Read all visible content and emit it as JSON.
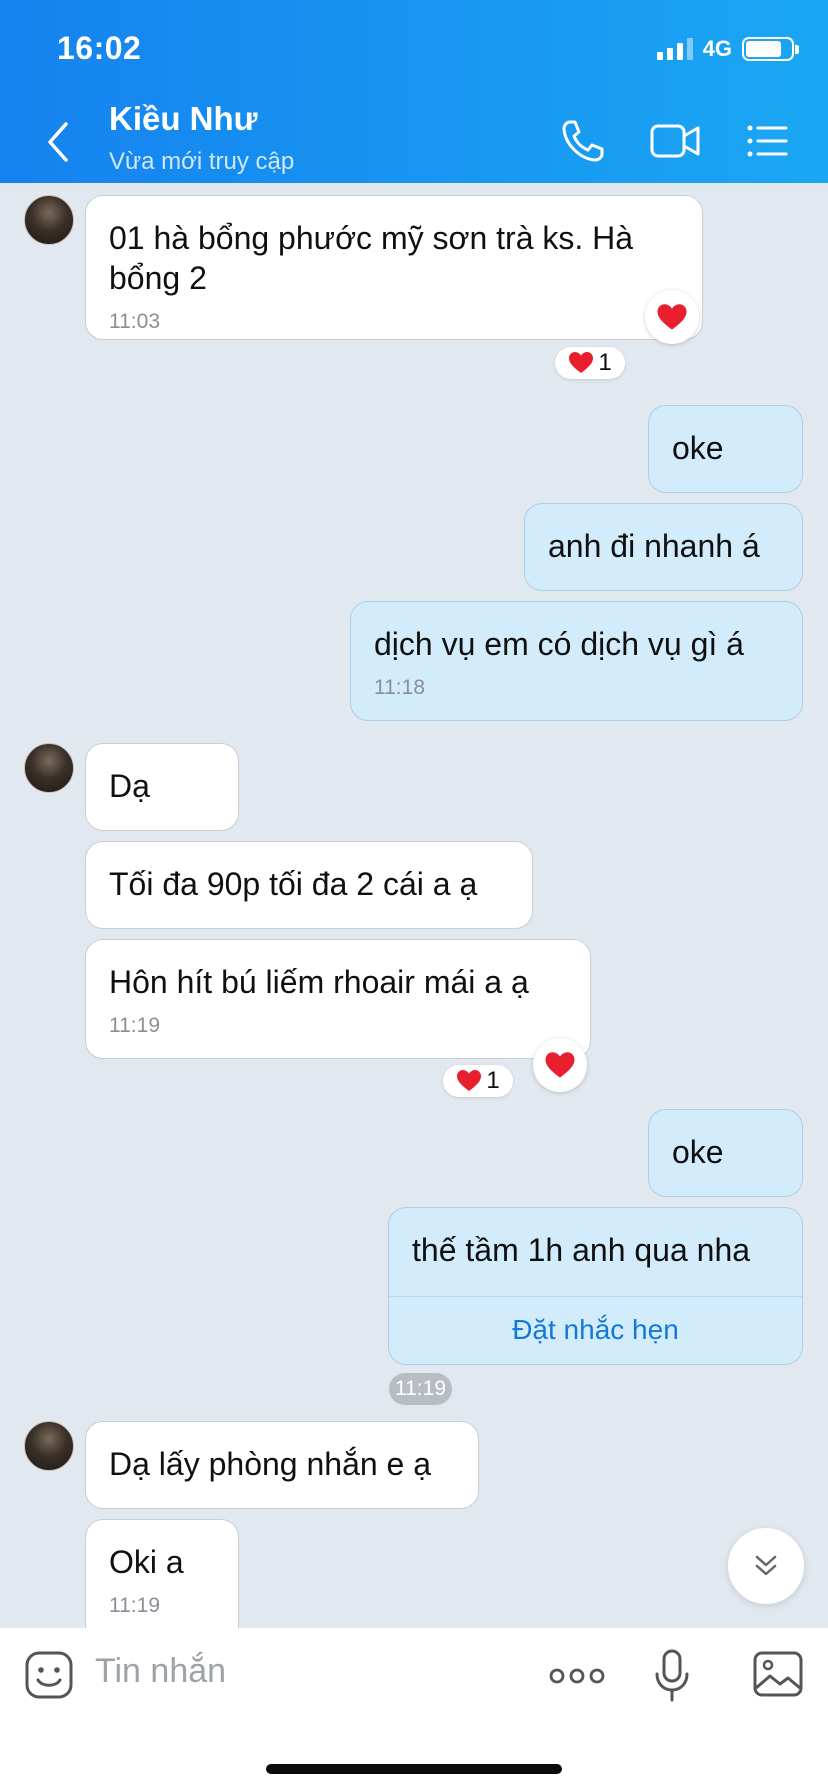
{
  "status_bar": {
    "time": "16:02",
    "network": "4G",
    "battery_percent": 80
  },
  "header": {
    "name": "Kiều Như",
    "status": "Vừa mới truy cập"
  },
  "messages": {
    "m1": {
      "text": "01 hà bổng phước mỹ sơn trà  ks. Hà bổng 2",
      "time": "11:03",
      "reaction_count": "1"
    },
    "m2": {
      "text": "oke"
    },
    "m3": {
      "text": "anh đi nhanh á"
    },
    "m4": {
      "text": "dịch vụ em có dịch vụ gì á",
      "time": "11:18"
    },
    "m5": {
      "text": "Dạ"
    },
    "m6": {
      "text": "Tối đa 90p tối đa 2 cái a ạ"
    },
    "m7": {
      "text": "Hôn hít bú liếm rhoair mái a ạ",
      "time": "11:19",
      "reaction_count": "1"
    },
    "m8": {
      "text": "oke"
    },
    "m9": {
      "text": "thế tầm 1h anh qua nha",
      "reminder_label": "Đặt nhắc hẹn",
      "time": "11:19"
    },
    "m10": {
      "text": "Dạ lấy phòng nhắn e ạ"
    },
    "m11": {
      "text": "Oki a",
      "time": "11:19"
    }
  },
  "composer": {
    "placeholder": "Tin nhắn"
  },
  "icons": {
    "back": "chevron-left-icon",
    "call": "phone-icon",
    "video": "video-camera-icon",
    "menu": "list-menu-icon",
    "reaction": "heart-icon",
    "scroll": "double-chevron-down-icon",
    "sticker": "sticker-icon",
    "more": "more-dots-icon",
    "mic": "microphone-icon",
    "gallery": "image-icon"
  },
  "colors": {
    "header_start": "#1582ef",
    "header_end": "#1aa7f3",
    "outgoing_bubble": "#d3ecfc",
    "background": "#e2e8f0",
    "reaction_heart": "#e8202e",
    "reminder_link": "#1478d8"
  }
}
